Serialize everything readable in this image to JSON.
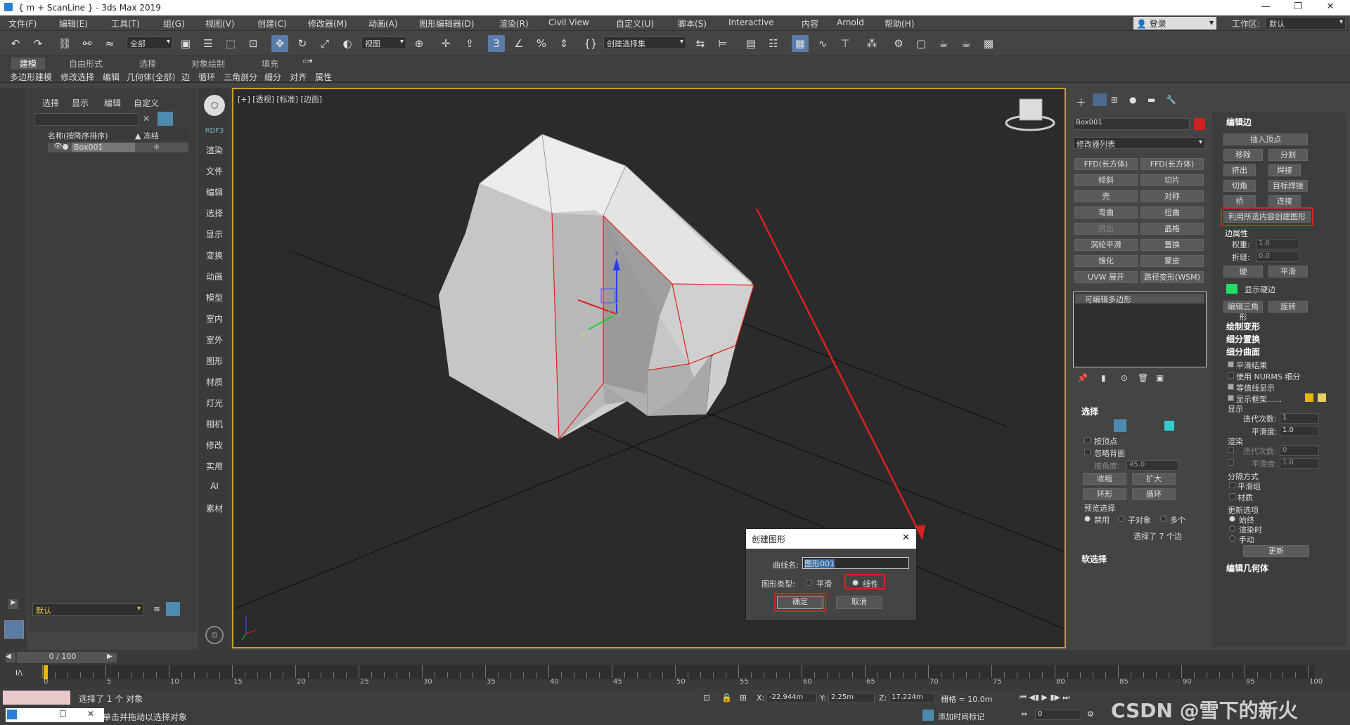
{
  "window": {
    "title": "{ m + ScanLine } - 3ds Max 2019"
  },
  "menu": [
    "文件(F)",
    "编辑(E)",
    "工具(T)",
    "组(G)",
    "视图(V)",
    "创建(C)",
    "修改器(M)",
    "动画(A)",
    "图形编辑器(D)",
    "渲染(R)",
    "Civil View",
    "自定义(U)",
    "脚本(S)",
    "Interactive",
    "内容",
    "Arnold",
    "帮助(H)"
  ],
  "login": "登录",
  "workspace": {
    "label": "工作区:",
    "value": "默认"
  },
  "toolbar": {
    "filter": "全部",
    "coord": "视图",
    "selset": "创建选择集"
  },
  "ribbon": {
    "tabs": [
      "建模",
      "自由形式",
      "选择",
      "对象绘制",
      "填充"
    ],
    "sub": [
      "多边形建模",
      "修改选择",
      "编辑",
      "几何体(全部)",
      "边",
      "循环",
      "三角剖分",
      "细分",
      "对齐",
      "属性"
    ]
  },
  "scene": {
    "tabs": [
      "选择",
      "显示",
      "编辑",
      "自定义"
    ],
    "col_name": "名称(按降序排序)",
    "col_freeze": "▲ 冻结",
    "item": "Box001",
    "layer": "默认"
  },
  "cmd": {
    "top": "RDF3",
    "items": [
      "渲染",
      "文件",
      "编辑",
      "选择",
      "显示",
      "变换",
      "动画",
      "模型",
      "室内",
      "室外",
      "图形",
      "材质",
      "灯光",
      "相机",
      "修改",
      "实用",
      "AI",
      "素材"
    ]
  },
  "viewport": {
    "label": "[+] [透视] [标准] [边面]"
  },
  "mod": {
    "name": "Box001",
    "list": "修改器列表",
    "buttons": [
      "FFD(长方体)",
      "FFD(长方体)",
      "倾斜",
      "切片",
      "壳",
      "对称",
      "弯曲",
      "扭曲",
      "挤出",
      "晶格",
      "涡轮平滑",
      "置换",
      "锥化",
      "蒙皮",
      "UVW 展开",
      "路径变形(WSM)"
    ],
    "stack": "可编辑多边形",
    "sel_hdr": "选择",
    "by_vertex": "按顶点",
    "ignore_back": "忽略背面",
    "by_angle": "按角度:",
    "angle": "45.0",
    "shrink": "收缩",
    "grow": "扩大",
    "ring": "环形",
    "loop": "循环",
    "preview": "预览选择",
    "preview_opts": [
      "禁用",
      "子对象",
      "多个"
    ],
    "selected": "选择了 7 个边",
    "soft": "软选择"
  },
  "edit": {
    "hdr": "编辑边",
    "insert": "插入顶点",
    "remove": "移除",
    "split": "分割",
    "extrude": "挤出",
    "weld": "焊接",
    "chamfer": "切角",
    "target_weld": "目标焊接",
    "bridge": "桥",
    "connect": "连接",
    "create_shape": "利用所选内容创建图形",
    "edge_props": "边属性",
    "weight_lbl": "权重:",
    "weight": "1.0",
    "crease_lbl": "折缝:",
    "crease": "0.0",
    "hard": "硬",
    "smooth": "平滑",
    "show_hard": "显示硬边",
    "edit_tri": "编辑三角形",
    "turn": "旋转",
    "paint": "绘制变形",
    "subdiv_disp": "细分置换",
    "subdiv_surf": "细分曲面",
    "smooth_result": "平滑结果",
    "nurms": "使用 NURMS 细分",
    "iso": "等值线显示",
    "cage": "显示框架......",
    "display": "显示",
    "iter_lbl": "迭代次数:",
    "iter": "1",
    "smooth_lbl": "平滑度:",
    "smoothv": "1.0",
    "render": "渲染",
    "iter2": "0",
    "smooth2": "1.0",
    "sep": "分隔方式",
    "sep1": "平滑组",
    "sep2": "材质",
    "update": "更新选项",
    "up1": "始终",
    "up2": "渲染时",
    "up3": "手动",
    "update_btn": "更新",
    "edit_geo": "编辑几何体",
    "colors": {
      "hard": "#22dd66",
      "cage1": "#e6b800",
      "cage2": "#e6d060",
      "obj": "#d42020"
    }
  },
  "dialog": {
    "title": "创建图形",
    "curve_lbl": "曲线名:",
    "curve": "图形001",
    "type_lbl": "图形类型:",
    "smooth": "平滑",
    "linear": "线性",
    "ok": "确定",
    "cancel": "取消"
  },
  "time": {
    "frame": "0 / 100",
    "ticks": [
      "0",
      "5",
      "10",
      "15",
      "20",
      "25",
      "30",
      "35",
      "40",
      "45",
      "50",
      "55",
      "60",
      "65",
      "70",
      "75",
      "80",
      "85",
      "90",
      "95",
      "100"
    ]
  },
  "status": {
    "sel": "选择了 1 个 对象",
    "hint": "单击并拖动以选择对象",
    "x": "-22.944m",
    "y": "2.25m",
    "z": "17.224m",
    "grid": "栅格 = 10.0m",
    "addtime": "添加时间标记",
    "frame": "0",
    "watermark": "CSDN @雪下的新火"
  }
}
